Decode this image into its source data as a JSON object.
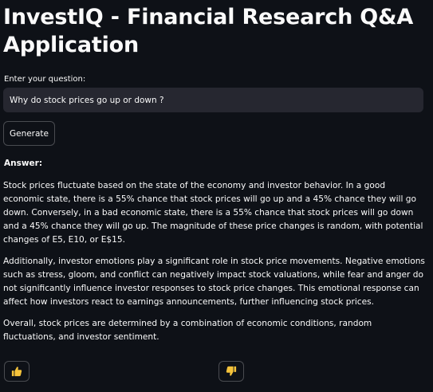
{
  "header": {
    "title": "InvestIQ - Financial Research Q&A Application"
  },
  "question": {
    "label": "Enter your question:",
    "value": "Why do stock prices go up or down ?",
    "generate_label": "Generate"
  },
  "answer": {
    "label": "Answer:",
    "paragraphs": [
      "Stock prices fluctuate based on the state of the economy and investor behavior. In a good economic state, there is a 55% chance that stock prices will go up and a 45% chance they will go down. Conversely, in a bad economic state, there is a 55% chance that stock prices will go down and a 45% chance they will go up. The magnitude of these price changes is random, with potential changes of E5, E10, or E$15.",
      "Additionally, investor emotions play a significant role in stock price movements. Negative emotions such as stress, gloom, and conflict can negatively impact stock valuations, while fear and anger do not significantly influence investor responses to stock price changes. This emotional response can affect how investors react to earnings announcements, further influencing stock prices.",
      "Overall, stock prices are determined by a combination of economic conditions, random fluctuations, and investor sentiment."
    ]
  },
  "feedback": {
    "thumbs_up_icon": "thumbs-up-icon",
    "thumbs_down_icon": "thumbs-down-icon",
    "icon_color": "#f5c33b"
  }
}
